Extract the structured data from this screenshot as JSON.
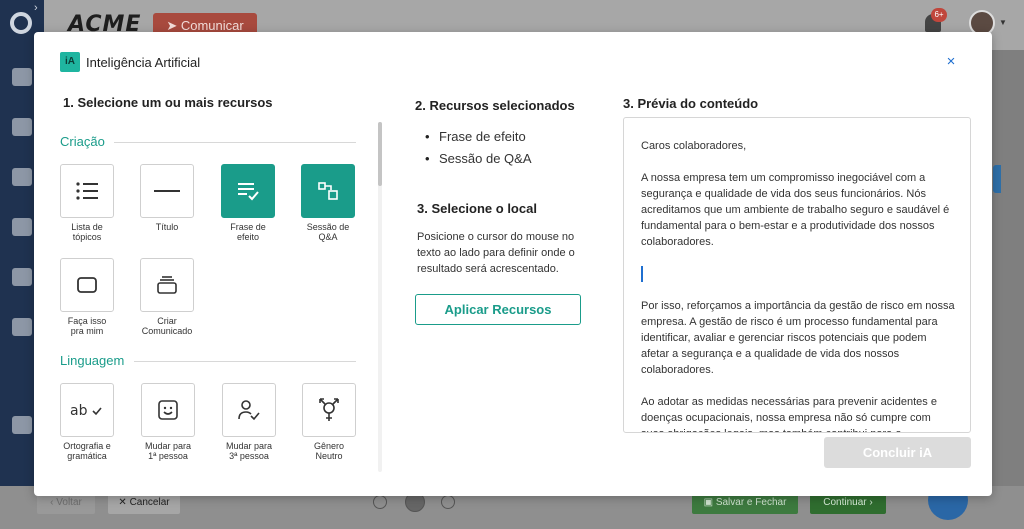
{
  "background": {
    "brand": "ACME",
    "comunicar_label": "Comunicar",
    "notifications_badge": "6+",
    "footer": {
      "voltar_label": "Voltar",
      "cancelar_label": "Cancelar",
      "salvar_label": "Salvar e Fechar",
      "continuar_label": "Continuar"
    }
  },
  "modal": {
    "logo_text": "iA",
    "title": "Inteligência Artificial",
    "close_icon": "×",
    "step1": {
      "title": "1. Selecione um ou mais recursos",
      "categories": [
        {
          "name": "Criação",
          "tools": [
            {
              "label": "Lista de tópicos",
              "icon": "list-icon",
              "selected": false
            },
            {
              "label": "Título",
              "icon": "title-icon",
              "selected": false
            },
            {
              "label": "Frase de efeito",
              "icon": "tagline-icon",
              "selected": true
            },
            {
              "label": "Sessão de Q&A",
              "icon": "qa-icon",
              "selected": true
            },
            {
              "label": "Faça isso pra mim",
              "icon": "rectangle-icon",
              "selected": false
            },
            {
              "label": "Criar Comunicado",
              "icon": "stack-icon",
              "selected": false
            }
          ]
        },
        {
          "name": "Linguagem",
          "tools": [
            {
              "label": "Ortografia e gramática",
              "icon": "spellcheck-icon",
              "selected": false
            },
            {
              "label": "Mudar para 1ª pessoa",
              "icon": "first-person-icon",
              "selected": false
            },
            {
              "label": "Mudar para 3ª pessoa",
              "icon": "third-person-icon",
              "selected": false
            },
            {
              "label": "Gênero Neutro",
              "icon": "gender-neutral-icon",
              "selected": false
            }
          ]
        }
      ]
    },
    "step2": {
      "title": "2. Recursos selecionados",
      "items": [
        "Frase de efeito",
        "Sessão de Q&A"
      ]
    },
    "step3": {
      "title": "3. Selecione o local",
      "instructions": "Posicione o cursor do mouse no texto ao lado para definir onde o resultado será acrescentado.",
      "apply_label": "Aplicar Recursos"
    },
    "preview": {
      "title": "3. Prévia do conteúdo",
      "paragraphs": [
        "Caros colaboradores,",
        "A nossa empresa tem um compromisso inegociável com a segurança e qualidade de vida dos seus funcionários. Nós acreditamos que um ambiente de trabalho seguro e saudável é fundamental para o bem-estar e a produtividade dos nossos colaboradores.",
        "Por isso, reforçamos a importância da gestão de risco em nossa empresa. A gestão de risco é um processo fundamental para identificar, avaliar e gerenciar riscos potenciais que podem afetar a segurança e a qualidade de vida dos nossos colaboradores.",
        "Ao adotar as medidas necessárias para prevenir acidentes e doenças ocupacionais, nossa empresa não só cumpre com suas obrigações legais, mas também contribui para o"
      ]
    },
    "conclude_label": "Concluir iA"
  },
  "colors": {
    "accent": "#1a9c8a",
    "link": "#1f6fd0"
  }
}
